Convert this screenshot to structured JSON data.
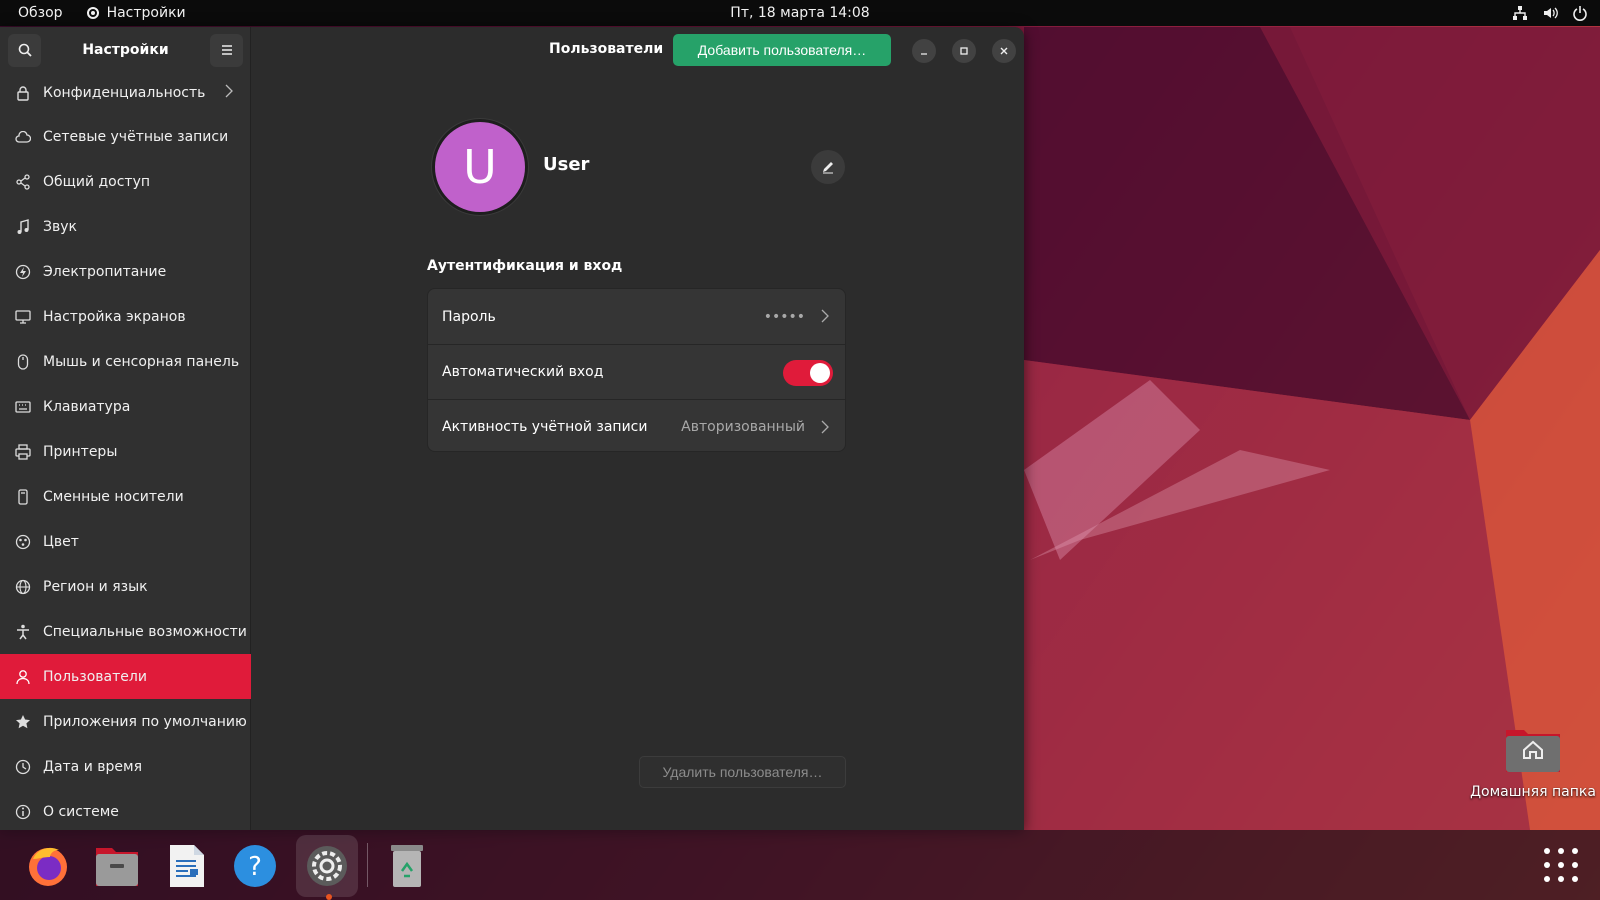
{
  "topbar": {
    "activities": "Обзор",
    "app_name": "Настройки",
    "clock": "Пт, 18 марта  14:08",
    "tray_icons": [
      "network-icon",
      "volume-icon",
      "power-icon"
    ]
  },
  "sidebar": {
    "title": "Настройки",
    "items": [
      {
        "label": "Конфиденциальность",
        "icon": "lock-icon"
      },
      {
        "label": "Сетевые учётные записи",
        "icon": "cloud-icon"
      },
      {
        "label": "Общий доступ",
        "icon": "share-icon"
      },
      {
        "label": "Звук",
        "icon": "music-note-icon"
      },
      {
        "label": "Электропитание",
        "icon": "power-bolt-icon"
      },
      {
        "label": "Настройка экранов",
        "icon": "display-icon"
      },
      {
        "label": "Мышь и сенсорная панель",
        "icon": "mouse-icon"
      },
      {
        "label": "Клавиатура",
        "icon": "keyboard-icon"
      },
      {
        "label": "Принтеры",
        "icon": "printer-icon"
      },
      {
        "label": "Сменные носители",
        "icon": "removable-media-icon"
      },
      {
        "label": "Цвет",
        "icon": "color-palette-icon"
      },
      {
        "label": "Регион и язык",
        "icon": "globe-icon"
      },
      {
        "label": "Специальные возможности",
        "icon": "accessibility-icon"
      },
      {
        "label": "Пользователи",
        "icon": "user-icon",
        "active": true
      },
      {
        "label": "Приложения по умолчанию",
        "icon": "star-icon"
      },
      {
        "label": "Дата и время",
        "icon": "clock-icon"
      },
      {
        "label": "О системе",
        "icon": "info-icon"
      }
    ]
  },
  "content": {
    "title": "Пользователи",
    "add_user": "Добавить пользователя…",
    "avatar_letter": "U",
    "user_name": "User",
    "auth_section_title": "Аутентификация и вход",
    "rows": {
      "password_label": "Пароль",
      "password_value": "•••••",
      "autologin_label": "Автоматический вход",
      "autologin_enabled": true,
      "activity_label": "Активность учётной записи",
      "activity_value": "Авторизованный"
    },
    "delete_user": "Удалить пользователя…"
  },
  "desktop": {
    "home_folder_label": "Домашняя папка"
  },
  "dock": {
    "apps": [
      "firefox-icon",
      "files-icon",
      "writer-icon",
      "help-icon",
      "settings-icon",
      "trash-icon"
    ],
    "running": "settings-icon"
  },
  "colors": {
    "accent": "#e01b3a",
    "add_button": "#26a269",
    "avatar": "#c061cb"
  }
}
